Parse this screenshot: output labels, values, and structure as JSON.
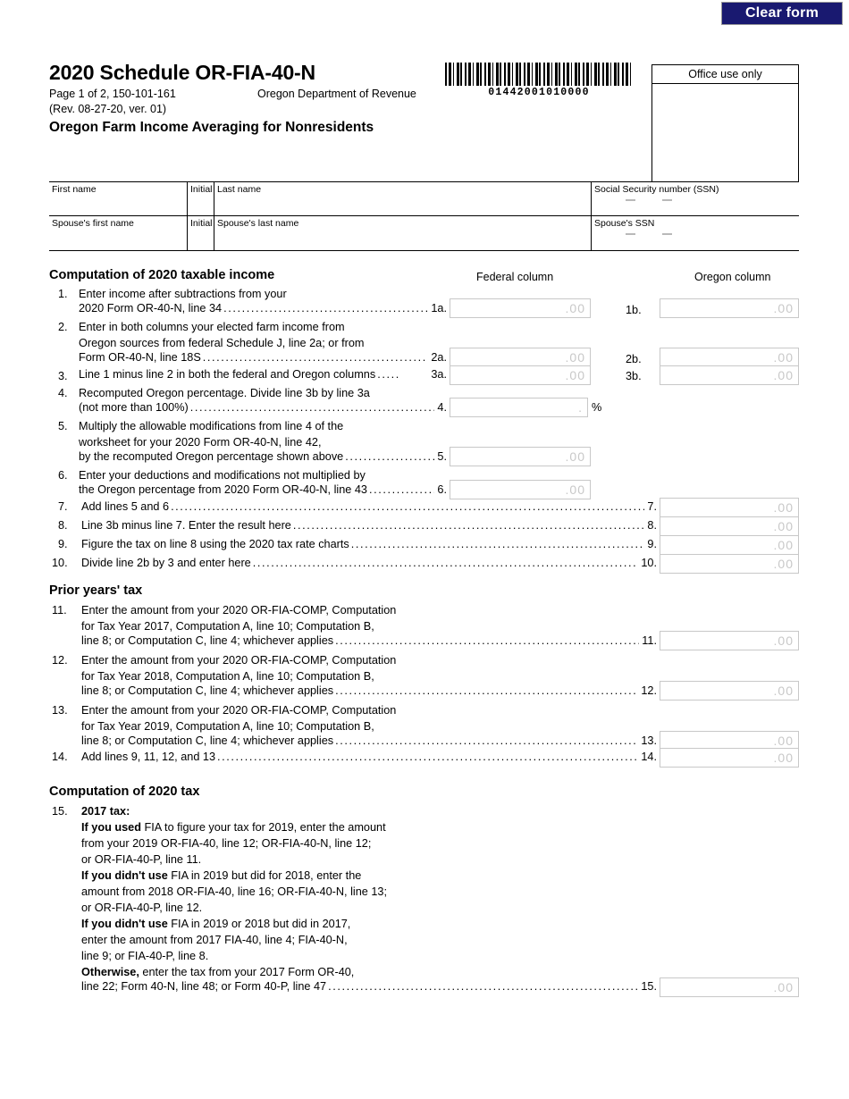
{
  "toolbar": {
    "clear_form_label": "Clear form"
  },
  "header": {
    "title": "2020 Schedule OR-FIA-40-N",
    "page_meta_line1": "Page 1 of 2, 150-101-161",
    "page_meta_line2": "(Rev. 08-27-20, ver. 01)",
    "department": "Oregon Department of Revenue",
    "subtitle": "Oregon Farm Income Averaging for Nonresidents",
    "barcode_number": "01442001010000",
    "office_use_label": "Office use only"
  },
  "name_fields": {
    "row1": {
      "first_name": "First name",
      "initial": "Initial",
      "last_name": "Last name",
      "ssn": "Social Security number (SSN)"
    },
    "row2": {
      "first_name": "Spouse's first name",
      "initial": "Initial",
      "last_name": "Spouse's last name",
      "ssn": "Spouse's SSN"
    }
  },
  "columns": {
    "federal": "Federal column",
    "oregon": "Oregon column"
  },
  "placeholders": {
    "money": ".00",
    "percent": "."
  },
  "sections": {
    "taxable_income": "Computation of 2020 taxable income",
    "prior_years": "Prior years' tax",
    "tax_computation": "Computation of 2020 tax"
  },
  "lines": {
    "l1": {
      "num": "1.",
      "text_a": "Enter income after subtractions from your",
      "text_b": "2020 Form OR-40-N, line 34",
      "ref_fed": "1a.",
      "ref_or": "1b."
    },
    "l2": {
      "num": "2.",
      "text_a": "Enter in both columns your elected farm income from",
      "text_b": "Oregon sources from federal Schedule J, line 2a; or from",
      "text_c": "Form OR-40-N, line 18S",
      "ref_fed": "2a.",
      "ref_or": "2b."
    },
    "l3": {
      "num": "3.",
      "text_a": "Line 1 minus line 2 in both the federal and Oregon columns",
      "ref_fed": "3a.",
      "ref_or": "3b."
    },
    "l4": {
      "num": "4.",
      "text_a": "Recomputed Oregon percentage. Divide line 3b by line 3a",
      "text_b": "(not more than 100%)",
      "ref": "4.",
      "percent_symbol": "%"
    },
    "l5": {
      "num": "5.",
      "text_a": "Multiply the allowable modifications from line 4 of the",
      "text_b": "worksheet for your 2020 Form OR-40-N, line 42,",
      "text_c": "by the recomputed Oregon percentage shown above",
      "ref": "5."
    },
    "l6": {
      "num": "6.",
      "text_a": "Enter your deductions and modifications not multiplied by",
      "text_b": "the Oregon percentage from 2020 Form OR-40-N, line 43",
      "ref": "6."
    },
    "l7": {
      "num": "7.",
      "text_a": "Add lines 5 and 6",
      "ref": "7."
    },
    "l8": {
      "num": "8.",
      "text_a": "Line 3b minus line 7. Enter the result here",
      "ref": "8."
    },
    "l9": {
      "num": "9.",
      "text_a": "Figure the tax on line 8 using the 2020 tax rate charts",
      "ref": "9."
    },
    "l10": {
      "num": "10.",
      "text_a": "Divide line 2b by 3 and enter here",
      "ref": "10."
    },
    "l11": {
      "num": "11.",
      "text_a": "Enter the amount from your 2020 OR-FIA-COMP, Computation",
      "text_b": "for Tax Year 2017, Computation A, line 10; Computation B,",
      "text_c": "line 8; or Computation C, line 4; whichever applies",
      "ref": "11."
    },
    "l12": {
      "num": "12.",
      "text_a": "Enter the amount from your 2020 OR-FIA-COMP, Computation",
      "text_b": "for Tax Year 2018, Computation A, line 10; Computation B,",
      "text_c": "line 8; or Computation C, line 4; whichever applies",
      "ref": "12."
    },
    "l13": {
      "num": "13.",
      "text_a": "Enter the amount from your 2020 OR-FIA-COMP, Computation",
      "text_b": "for Tax Year 2019, Computation A, line 10; Computation B,",
      "text_c": "line 8; or Computation C, line 4; whichever applies",
      "ref": "13."
    },
    "l14": {
      "num": "14.",
      "text_a": "Add lines 9, 11, 12, and 13",
      "ref": "14."
    },
    "l15": {
      "num": "15.",
      "heading": "2017 tax:",
      "p1_bold": "If you used",
      "p1_rest": " FIA to figure your tax for 2019, enter the amount",
      "p1_line2": "from your 2019 OR-FIA-40, line 12; OR-FIA-40-N, line 12;",
      "p1_line3": "or OR-FIA-40-P, line 11.",
      "p2_bold": "If you didn't use",
      "p2_rest": " FIA in 2019 but did for 2018, enter the",
      "p2_line2": "amount from 2018 OR-FIA-40, line 16; OR-FIA-40-N, line 13;",
      "p2_line3": "or OR-FIA-40-P, line 12.",
      "p3_bold": "If you didn't use",
      "p3_rest": " FIA in 2019 or 2018 but did in 2017,",
      "p3_line2": "enter the amount from 2017 FIA-40, line 4; FIA-40-N,",
      "p3_line3": "line 9; or FIA-40-P, line 8.",
      "p4_bold": "Otherwise,",
      "p4_rest": " enter the tax from your 2017 Form OR-40,",
      "p4_line2": "line 22; Form 40-N, line 48; or Form 40-P, line 47",
      "ref": "15."
    }
  },
  "colors": {
    "button_bg": "#191970",
    "button_text": "#ffffff",
    "field_border": "#c8c8c8",
    "placeholder_text": "#c8c8c8"
  }
}
